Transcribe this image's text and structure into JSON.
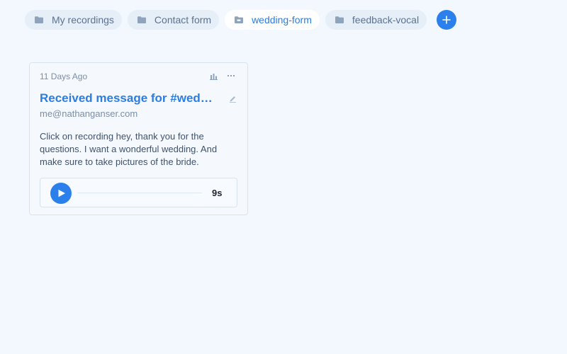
{
  "tabs": [
    {
      "label": "My recordings",
      "icon": "folder-icon",
      "active": false
    },
    {
      "label": "Contact form",
      "icon": "folder-icon",
      "active": false
    },
    {
      "label": "wedding-form",
      "icon": "folder-open-icon",
      "active": true
    },
    {
      "label": "feedback-vocal",
      "icon": "folder-icon",
      "active": false
    }
  ],
  "add_button_icon": "plus-icon",
  "card": {
    "date": "11 Days Ago",
    "title": "Received message for #wedding-form",
    "email": "me@nathanganser.com",
    "message": "Click on recording hey, thank you for the questions. I want a wonderful wedding. And make sure to take pictures of the bride.",
    "icons": {
      "stats": "bar-chart-icon",
      "more": "more-dots-icon",
      "edit": "pencil-icon"
    },
    "player": {
      "duration": "9s",
      "progress": 0,
      "icon": "play-icon"
    }
  },
  "colors": {
    "accent": "#2b80ec",
    "background": "#f3f8fe",
    "tab_bg": "#e6eef8",
    "muted_text": "#7a8ea6"
  }
}
